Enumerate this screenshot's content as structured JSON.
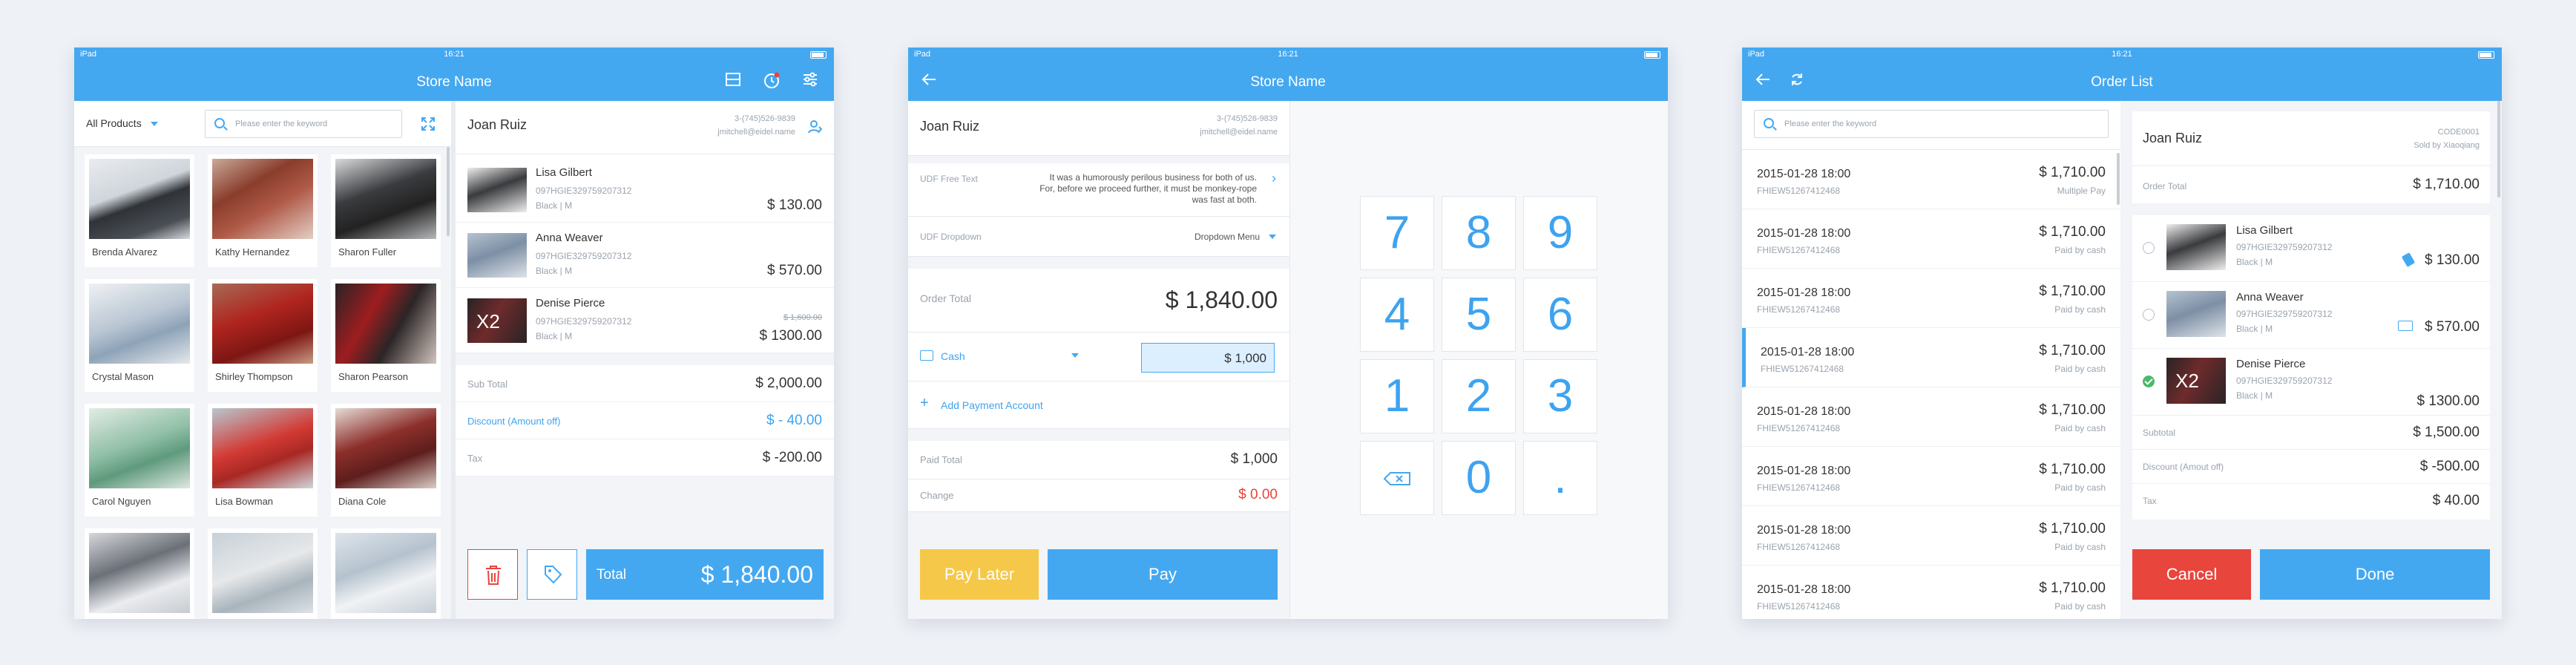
{
  "colors": {
    "accent": "#44a8f1",
    "danger": "#e8453c",
    "pay_later": "#f6c84a",
    "success": "#4cb86a"
  },
  "status": {
    "device": "iPad",
    "time": "16:21"
  },
  "screen1": {
    "title": "Store Name",
    "filter_label": "All Products",
    "search_placeholder": "Please enter the keyword",
    "products": [
      "Brenda Alvarez",
      "Kathy Hernandez",
      "Sharon Fuller",
      "Crystal Mason",
      "Shirley Thompson",
      "Sharon Pearson",
      "Carol Nguyen",
      "Lisa Bowman",
      "Diana Cole"
    ],
    "customer": {
      "name": "Joan Ruiz",
      "phone": "3-(745)526-9839",
      "email": "jmitchell@eidel.name"
    },
    "cart_items": [
      {
        "name": "Lisa Gilbert",
        "code": "097HGIE329759207312",
        "variant": "Black | M",
        "price": "$ 130.00",
        "qty": "",
        "old_price": ""
      },
      {
        "name": "Anna Weaver",
        "code": "097HGIE329759207312",
        "variant": "Black | M",
        "price": "$ 570.00",
        "qty": "",
        "old_price": ""
      },
      {
        "name": "Denise Pierce",
        "code": "097HGIE329759207312",
        "variant": "Black | M",
        "price": "$ 1300.00",
        "qty": "X2",
        "old_price": "$ 1,600.00"
      }
    ],
    "subtotal_label": "Sub Total",
    "subtotal": "$ 2,000.00",
    "discount_label": "Discount (Amount off)",
    "discount": "$ - 40.00",
    "tax_label": "Tax",
    "tax": "$ -200.00",
    "total_label": "Total",
    "total": "$ 1,840.00"
  },
  "screen2": {
    "title": "Store Name",
    "customer": {
      "name": "Joan Ruiz",
      "phone": "3-(745)526-9839",
      "email": "jmitchell@eidel.name"
    },
    "udf_text_label": "UDF Free Text",
    "udf_text_value": "It was a humorously perilous business for both of us. For, before we proceed further, it must be monkey-rope was fast at both.",
    "udf_dropdown_label": "UDF Dropdown",
    "udf_dropdown_value": "Dropdown Menu",
    "order_total_label": "Order Total",
    "order_total": "$ 1,840.00",
    "payment_method": "Cash",
    "payment_amount": "$ 1,000",
    "add_payment": "Add Payment Account",
    "paid_total_label": "Paid Total",
    "paid_total": "$ 1,000",
    "change_label": "Change",
    "change": "$ 0.00",
    "pay_later": "Pay Later",
    "pay": "Pay",
    "keys": [
      "7",
      "8",
      "9",
      "4",
      "5",
      "6",
      "1",
      "2",
      "3",
      "",
      "0",
      "."
    ]
  },
  "screen3": {
    "title": "Order List",
    "search_placeholder": "Please enter the keyword",
    "orders": [
      {
        "date": "2015-01-28  18:00",
        "sn": "FHIEW51267412468",
        "amount": "$ 1,710.00",
        "method": "Multiple Pay"
      },
      {
        "date": "2015-01-28  18:00",
        "sn": "FHIEW51267412468",
        "amount": "$ 1,710.00",
        "method": "Paid by cash"
      },
      {
        "date": "2015-01-28  18:00",
        "sn": "FHIEW51267412468",
        "amount": "$ 1,710.00",
        "method": "Paid by cash"
      },
      {
        "date": "2015-01-28  18:00",
        "sn": "FHIEW51267412468",
        "amount": "$ 1,710.00",
        "method": "Paid by cash"
      },
      {
        "date": "2015-01-28  18:00",
        "sn": "FHIEW51267412468",
        "amount": "$ 1,710.00",
        "method": "Paid by cash"
      },
      {
        "date": "2015-01-28  18:00",
        "sn": "FHIEW51267412468",
        "amount": "$ 1,710.00",
        "method": "Paid by cash"
      },
      {
        "date": "2015-01-28  18:00",
        "sn": "FHIEW51267412468",
        "amount": "$ 1,710.00",
        "method": "Paid by cash"
      },
      {
        "date": "2015-01-28  18:00",
        "sn": "FHIEW51267412468",
        "amount": "$ 1,710.00",
        "method": "Paid by cash"
      }
    ],
    "customer": {
      "name": "Joan Ruiz",
      "code": "CODE0001",
      "sold_by": "Sold by Xiaoqiang"
    },
    "order_total_label": "Order Total",
    "order_total": "$ 1,710.00",
    "items": [
      {
        "name": "Lisa Gilbert",
        "code": "097HGIE329759207312",
        "variant": "Black | M",
        "price": "$ 130.00",
        "qty": ""
      },
      {
        "name": "Anna Weaver",
        "code": "097HGIE329759207312",
        "variant": "Black | M",
        "price": "$ 570.00",
        "qty": ""
      },
      {
        "name": "Denise Pierce",
        "code": "097HGIE329759207312",
        "variant": "Black | M",
        "price": "$ 1300.00",
        "qty": "X2"
      }
    ],
    "subtotal_label": "Subtotal",
    "subtotal": "$ 1,500.00",
    "discount_label": "Discount (Amout off)",
    "discount": "$ -500.00",
    "tax_label": "Tax",
    "tax": "$ 40.00",
    "cancel": "Cancel",
    "done": "Done"
  }
}
